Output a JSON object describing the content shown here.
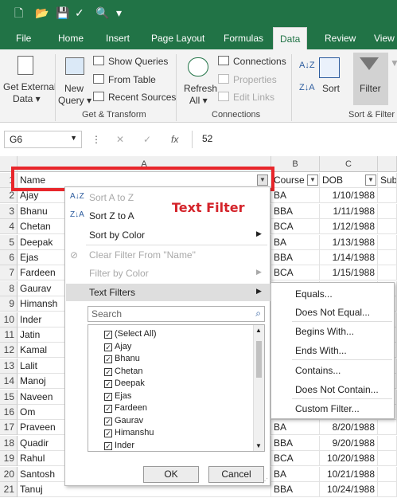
{
  "ribbon_tabs": [
    "File",
    "Home",
    "Insert",
    "Page Layout",
    "Formulas",
    "Data",
    "Review",
    "View"
  ],
  "ribbon": {
    "get_external_data": [
      "Get External",
      "Data ▾"
    ],
    "new_query": [
      "New",
      "Query ▾"
    ],
    "show_queries": "Show Queries",
    "from_table": "From Table",
    "recent_sources": "Recent Sources",
    "refresh_all": [
      "Refresh",
      "All ▾"
    ],
    "connections": "Connections",
    "properties": "Properties",
    "edit_links": "Edit Links",
    "sort_label": "Sort",
    "filter_label": "Filter",
    "groups": [
      "Get & Transform",
      "Connections",
      "Sort & Filter"
    ]
  },
  "formula_bar": {
    "name_box": "G6",
    "fx": "fx",
    "value": "52"
  },
  "columns": [
    "A",
    "B",
    "C"
  ],
  "headers": {
    "name": "Name",
    "course": "Course",
    "dob": "DOB",
    "sub": "Sub"
  },
  "rows": [
    {
      "n": "1"
    },
    {
      "n": "2",
      "name": "Ajay",
      "course": "BA",
      "dob": "1/10/1988"
    },
    {
      "n": "3",
      "name": "Bhanu",
      "course": "BBA",
      "dob": "1/11/1988"
    },
    {
      "n": "4",
      "name": "Chetan",
      "course": "BCA",
      "dob": "1/12/1988"
    },
    {
      "n": "5",
      "name": "Deepak",
      "course": "BA",
      "dob": "1/13/1988"
    },
    {
      "n": "6",
      "name": "Ejas",
      "course": "BBA",
      "dob": "1/14/1988"
    },
    {
      "n": "7",
      "name": "Fardeen",
      "course": "BCA",
      "dob": "1/15/1988"
    },
    {
      "n": "8",
      "name": "Gaurav",
      "course": "",
      "dob": ""
    },
    {
      "n": "9",
      "name": "Himansh",
      "course": "",
      "dob": ""
    },
    {
      "n": "10",
      "name": "Inder",
      "course": "",
      "dob": ""
    },
    {
      "n": "11",
      "name": "Jatin",
      "course": "",
      "dob": ""
    },
    {
      "n": "12",
      "name": "Kamal",
      "course": "",
      "dob": ""
    },
    {
      "n": "13",
      "name": "Lalit",
      "course": "",
      "dob": ""
    },
    {
      "n": "14",
      "name": "Manoj",
      "course": "",
      "dob": ""
    },
    {
      "n": "15",
      "name": "Naveen",
      "course": "",
      "dob": ""
    },
    {
      "n": "16",
      "name": "Om",
      "course": "",
      "dob": ""
    },
    {
      "n": "17",
      "name": "Praveen",
      "course": "BA",
      "dob": "8/20/1988"
    },
    {
      "n": "18",
      "name": "Quadir",
      "course": "BBA",
      "dob": "9/20/1988"
    },
    {
      "n": "19",
      "name": "Rahul",
      "course": "BCA",
      "dob": "10/20/1988"
    },
    {
      "n": "20",
      "name": "Santosh",
      "course": "BA",
      "dob": "10/21/1988"
    },
    {
      "n": "21",
      "name": "Tanuj",
      "course": "BBA",
      "dob": "10/24/1988"
    }
  ],
  "annotation": "Text Filter",
  "filter_menu": {
    "sort_az": "Sort A to Z",
    "sort_za": "Sort Z to A",
    "sort_color": "Sort by Color",
    "clear_filter": "Clear Filter From \"Name\"",
    "filter_color": "Filter by Color",
    "text_filters": "Text Filters",
    "search_placeholder": "Search",
    "items": [
      "(Select All)",
      "Ajay",
      "Bhanu",
      "Chetan",
      "Deepak",
      "Ejas",
      "Fardeen",
      "Gaurav",
      "Himanshu",
      "Inder"
    ],
    "ok": "OK",
    "cancel": "Cancel"
  },
  "text_filters_submenu": [
    "Equals...",
    "Does Not Equal...",
    "Begins With...",
    "Ends With...",
    "Contains...",
    "Does Not Contain...",
    "Custom Filter..."
  ]
}
